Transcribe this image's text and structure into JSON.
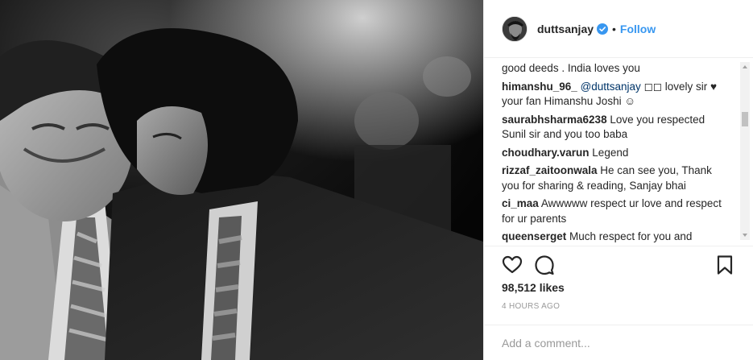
{
  "post": {
    "username": "duttsanjay",
    "verified": true,
    "follow_label": "Follow",
    "separator": "•",
    "photo_icon": "photo-black-and-white",
    "avatar_icon": "avatar-portrait"
  },
  "comments": [
    {
      "user": "",
      "text": "good deeds . India loves you"
    },
    {
      "user": "himanshu_96_",
      "mention": "@duttsanjay",
      "text": " ◻◻ lovely sir ♥ your fan Himanshu Joshi ☺"
    },
    {
      "user": "saurabhsharma6238",
      "text": "Love you respected Sunil sir and you too baba"
    },
    {
      "user": "choudhary.varun",
      "text": "Legend"
    },
    {
      "user": "rizzaf_zaitoonwala",
      "text": "He can see you, Thank you for sharing & reading, Sanjay bhai"
    },
    {
      "user": "ci_maa",
      "text": "Awwwww respect ur love and respect for ur parents"
    },
    {
      "user": "queenserget",
      "text": "Much respect for you and"
    }
  ],
  "actions": {
    "like_icon": "heart-icon",
    "comment_icon": "comment-icon",
    "save_icon": "bookmark-icon"
  },
  "likes_text": "98,512 likes",
  "time_text": "4 HOURS AGO",
  "add_comment": {
    "placeholder": "Add a comment..."
  },
  "colors": {
    "link": "#3897f0",
    "text": "#262626",
    "muted": "#999999",
    "border": "#efefef"
  }
}
